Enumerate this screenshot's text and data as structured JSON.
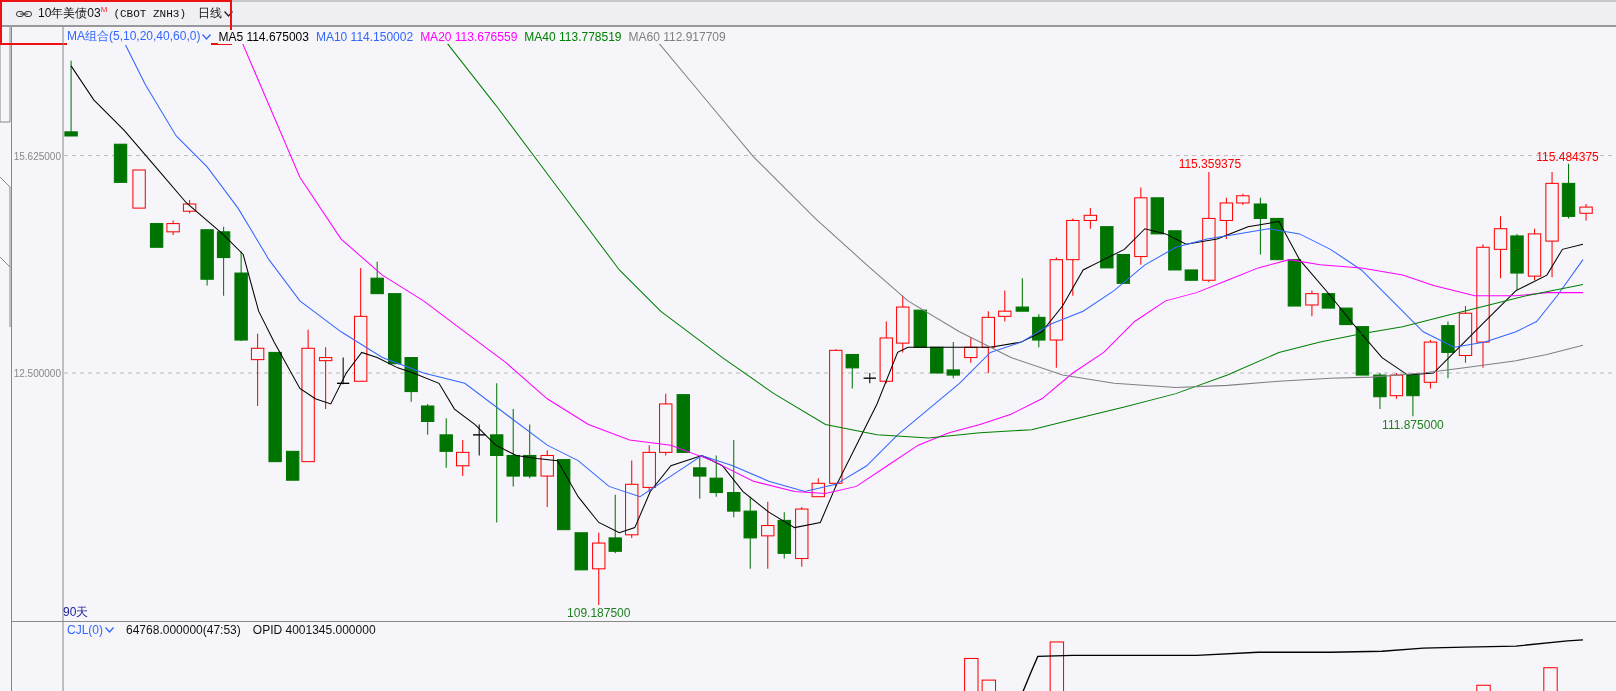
{
  "header": {
    "title": "10年美债03",
    "badge": "M",
    "code": "(CBOT ZNH3)",
    "period": "日线"
  },
  "price_pane": {
    "indicator": "MA组合(5,10,20,40,60,0)",
    "legend": [
      {
        "label": "MA5 114.675003",
        "color": "#000000"
      },
      {
        "label": "MA10 114.150002",
        "color": "#3366ff"
      },
      {
        "label": "MA20 113.676559",
        "color": "#ff00ff"
      },
      {
        "label": "MA40 113.778519",
        "color": "#008000"
      },
      {
        "label": "MA60 112.917709",
        "color": "#808080"
      }
    ],
    "axis_labels": [
      "15.625000",
      "12.500000"
    ],
    "price_marks": [
      {
        "text": "115.359375",
        "kind": "high"
      },
      {
        "text": "115.484375",
        "kind": "high"
      },
      {
        "text": "111.875000",
        "kind": "low"
      },
      {
        "text": "109.187500",
        "kind": "low"
      }
    ],
    "range": "90天"
  },
  "volume_pane": {
    "indicator": "CJL(0)",
    "readings": [
      "64768.000000(47:53)",
      "OPID 4001345.000000"
    ]
  }
}
